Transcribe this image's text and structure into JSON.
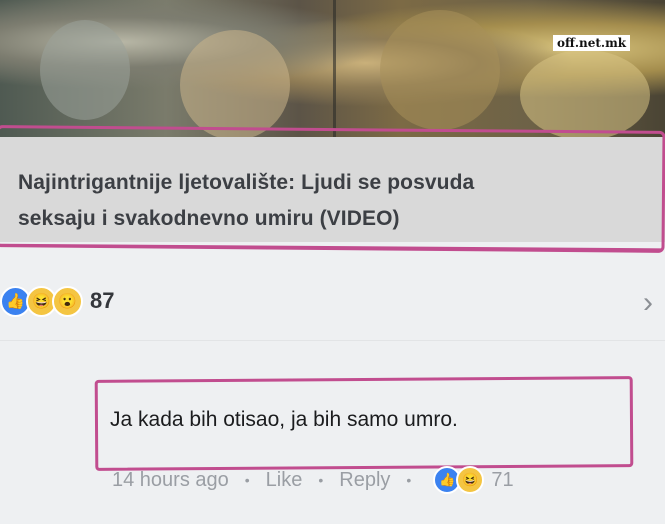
{
  "watermark": "off.net.mk",
  "post": {
    "headline_line1": "Najintrigantnije ljetovalište: Ljudi se posvuda",
    "headline_line2": "seksaju i svakodnevno umiru (VIDEO)",
    "reactions": {
      "icons": [
        "like-icon",
        "haha-icon",
        "wow-icon"
      ],
      "count": "87"
    }
  },
  "comment": {
    "text": "Ja kada bih otisao, ja bih samo umro.",
    "time": "14 hours ago",
    "like_label": "Like",
    "reply_label": "Reply",
    "reactions": {
      "icons": [
        "like-icon",
        "haha-icon"
      ],
      "count": "71"
    }
  },
  "colors": {
    "highlight": "#c14d8f",
    "like": "#3b82f0",
    "emoji": "#f4c542"
  }
}
